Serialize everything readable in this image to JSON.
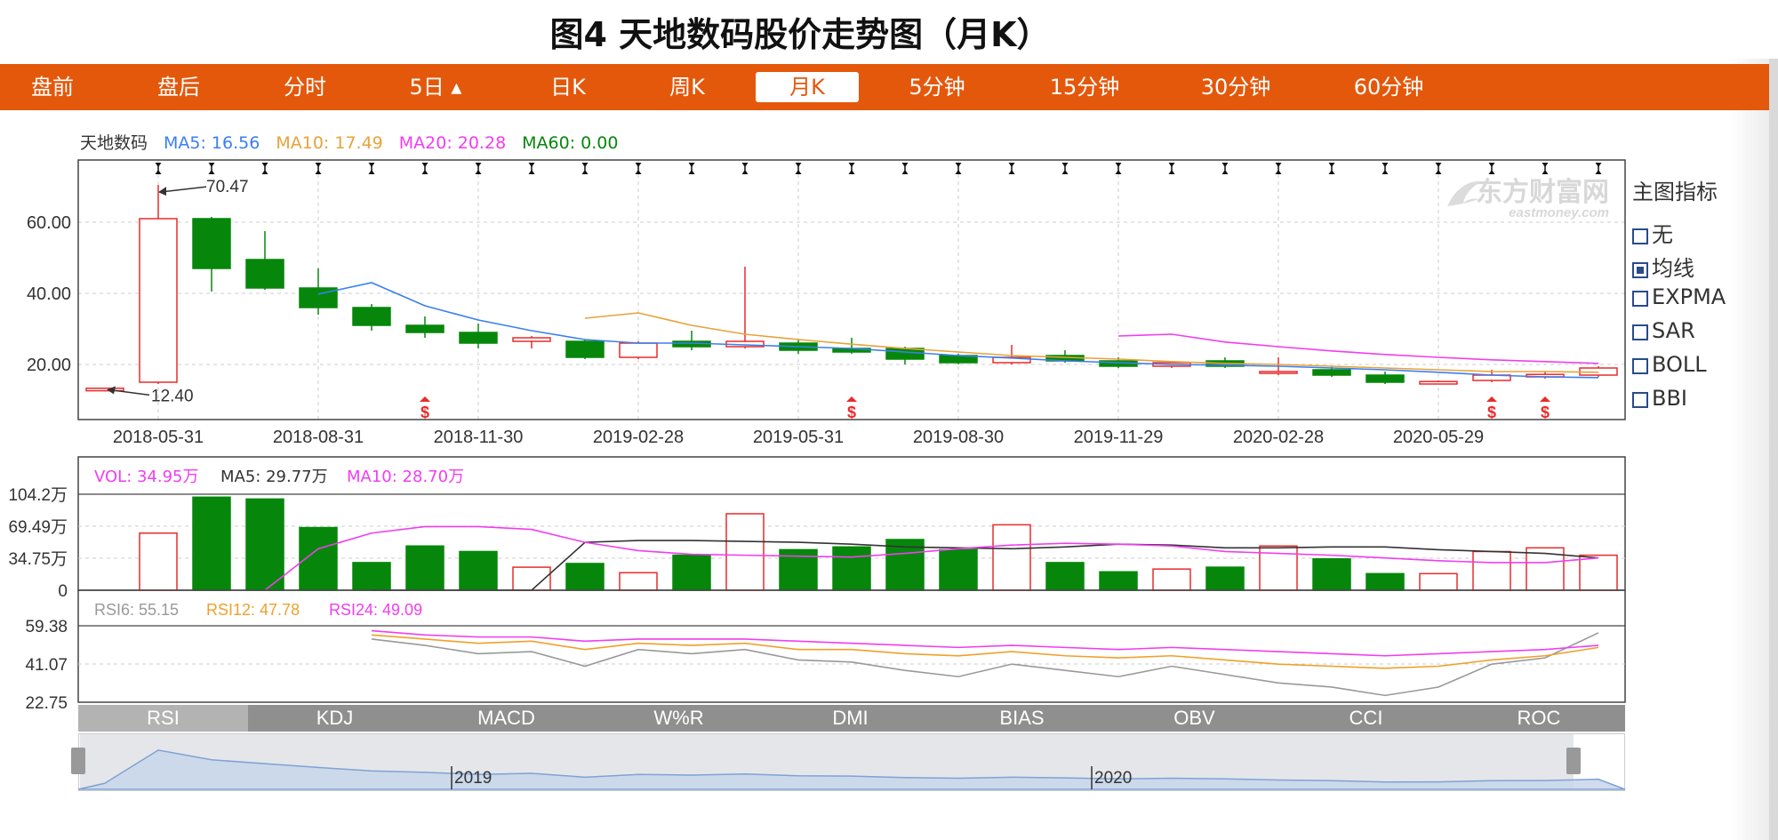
{
  "title": "图4 天地数码股价走势图（月K）",
  "tabs": [
    {
      "label": "盘前",
      "active": false
    },
    {
      "label": "盘后",
      "active": false
    },
    {
      "label": "分时",
      "active": false
    },
    {
      "label": "5日 ▴",
      "active": false
    },
    {
      "label": "日K",
      "active": false
    },
    {
      "label": "周K",
      "active": false
    },
    {
      "label": "月K",
      "active": true
    },
    {
      "label": "5分钟",
      "active": false
    },
    {
      "label": "15分钟",
      "active": false
    },
    {
      "label": "30分钟",
      "active": false
    },
    {
      "label": "60分钟",
      "active": false
    }
  ],
  "legend": {
    "stock": "天地数码",
    "ma5": "MA5: 16.56",
    "ma10": "MA10: 17.49",
    "ma20": "MA20: 20.28",
    "ma60": "MA60: 0.00"
  },
  "side_panel": {
    "title": "主图指标",
    "options": [
      {
        "label": "无",
        "checked": false
      },
      {
        "label": "均线",
        "checked": true
      },
      {
        "label": "EXPMA",
        "checked": false
      },
      {
        "label": "SAR",
        "checked": false
      },
      {
        "label": "BOLL",
        "checked": false
      },
      {
        "label": "BBI",
        "checked": false
      }
    ]
  },
  "indicator_tabs": [
    {
      "label": "RSI",
      "active": true
    },
    {
      "label": "KDJ",
      "active": false
    },
    {
      "label": "MACD",
      "active": false
    },
    {
      "label": "W%R",
      "active": false
    },
    {
      "label": "DMI",
      "active": false
    },
    {
      "label": "BIAS",
      "active": false
    },
    {
      "label": "OBV",
      "active": false
    },
    {
      "label": "CCI",
      "active": false
    },
    {
      "label": "ROC",
      "active": false
    }
  ],
  "watermark": {
    "cn": "东方财富网",
    "en": "eastmoney.com"
  },
  "navigator": {
    "labels": [
      "2019",
      "2020"
    ],
    "label_month_index": [
      7,
      19
    ]
  },
  "colors": {
    "orange": "#e4580b",
    "up": "#e82b2b",
    "down": "#06870b",
    "ma5": "#3b7ff0",
    "ma10": "#e8a23a",
    "ma20": "#f13df0",
    "ma60": "#06870b",
    "vol_ma5": "#333333",
    "rsi6": "#999999",
    "rsi12": "#f0a02b",
    "rsi24": "#f13df0"
  },
  "chart_data": [
    {
      "type": "candlestick",
      "x_tick_labels": [
        "2018-05-31",
        "2018-08-31",
        "2018-11-30",
        "2019-02-28",
        "2019-05-31",
        "2019-08-30",
        "2019-11-29",
        "2020-02-28",
        "2020-05-29"
      ],
      "x_tick_month_index": [
        1,
        4,
        7,
        10,
        13,
        16,
        19,
        22,
        25
      ],
      "y_tick_labels": [
        "60.00",
        "40.00",
        "20.00"
      ],
      "y_ticks": [
        60,
        40,
        20
      ],
      "ylim": [
        4.5,
        77.5
      ],
      "annotations": {
        "max_label": "70.47",
        "max_value": 70.47,
        "min_label": "12.40",
        "min_value": 12.4
      },
      "dividend_markers_month_index": [
        6,
        14,
        26,
        27
      ],
      "candles": [
        {
          "o": 12.6,
          "h": 13.5,
          "l": 12.4,
          "c": 13.3
        },
        {
          "o": 15.0,
          "h": 70.47,
          "l": 14.5,
          "c": 61.0
        },
        {
          "o": 61.0,
          "h": 61.5,
          "l": 40.5,
          "c": 47.0
        },
        {
          "o": 49.5,
          "h": 57.5,
          "l": 41.0,
          "c": 41.5
        },
        {
          "o": 41.5,
          "h": 47.0,
          "l": 34.0,
          "c": 36.0
        },
        {
          "o": 36.0,
          "h": 37.0,
          "l": 29.5,
          "c": 31.0
        },
        {
          "o": 31.0,
          "h": 33.5,
          "l": 27.5,
          "c": 29.0
        },
        {
          "o": 29.0,
          "h": 31.5,
          "l": 24.5,
          "c": 26.0
        },
        {
          "o": 26.5,
          "h": 28.0,
          "l": 24.5,
          "c": 27.5
        },
        {
          "o": 26.5,
          "h": 27.0,
          "l": 21.5,
          "c": 22.0
        },
        {
          "o": 22.0,
          "h": 26.5,
          "l": 21.5,
          "c": 26.0
        },
        {
          "o": 26.5,
          "h": 29.5,
          "l": 24.0,
          "c": 25.0
        },
        {
          "o": 25.0,
          "h": 47.5,
          "l": 24.5,
          "c": 26.5
        },
        {
          "o": 26.0,
          "h": 27.0,
          "l": 23.0,
          "c": 24.0
        },
        {
          "o": 24.5,
          "h": 27.5,
          "l": 23.0,
          "c": 23.5
        },
        {
          "o": 24.5,
          "h": 25.0,
          "l": 20.0,
          "c": 21.5
        },
        {
          "o": 22.5,
          "h": 23.0,
          "l": 20.0,
          "c": 20.5
        },
        {
          "o": 20.5,
          "h": 25.5,
          "l": 20.0,
          "c": 22.0
        },
        {
          "o": 22.5,
          "h": 24.0,
          "l": 20.5,
          "c": 21.0
        },
        {
          "o": 21.0,
          "h": 22.0,
          "l": 19.0,
          "c": 19.5
        },
        {
          "o": 19.5,
          "h": 21.0,
          "l": 19.0,
          "c": 20.5
        },
        {
          "o": 21.0,
          "h": 22.0,
          "l": 19.0,
          "c": 19.5
        },
        {
          "o": 17.5,
          "h": 22.0,
          "l": 17.0,
          "c": 18.0
        },
        {
          "o": 18.5,
          "h": 19.5,
          "l": 16.5,
          "c": 17.0
        },
        {
          "o": 17.0,
          "h": 18.0,
          "l": 14.5,
          "c": 15.0
        },
        {
          "o": 14.5,
          "h": 15.5,
          "l": 14.5,
          "c": 15.2
        },
        {
          "o": 15.5,
          "h": 18.5,
          "l": 15.0,
          "c": 17.0
        },
        {
          "o": 16.5,
          "h": 18.0,
          "l": 16.0,
          "c": 17.2
        },
        {
          "o": 17.0,
          "h": 19.5,
          "l": 16.5,
          "c": 19.0
        }
      ],
      "series": [
        {
          "name": "MA5",
          "start": 4,
          "values": [
            39.8,
            43.0,
            36.5,
            32.5,
            29.5,
            27.0,
            26.0,
            26.0,
            25.5,
            25.0,
            24.5,
            23.5,
            22.5,
            21.8,
            21.0,
            20.5,
            20.0,
            19.8,
            19.5,
            19.0,
            18.5,
            17.8,
            17.0,
            16.5,
            16.3
          ]
        },
        {
          "name": "MA10",
          "start": 9,
          "values": [
            33.0,
            34.5,
            31.0,
            28.5,
            27.0,
            25.7,
            24.5,
            23.5,
            22.5,
            22.0,
            21.5,
            20.8,
            20.3,
            20.0,
            19.5,
            19.0,
            18.5,
            18.0,
            18.0,
            17.8
          ]
        },
        {
          "name": "MA20",
          "start": 19,
          "values": [
            28.0,
            28.5,
            26.3,
            25.0,
            23.8,
            22.8,
            22.0,
            21.3,
            20.8,
            20.3
          ]
        }
      ]
    },
    {
      "type": "bar",
      "title": "VOL",
      "legend": {
        "vol": "VOL: 34.95万",
        "ma5": "MA5: 29.77万",
        "ma10": "MA10: 28.70万"
      },
      "y_tick_labels": [
        "104.2万",
        "69.49万",
        "34.75万",
        "0"
      ],
      "y_ticks": [
        104.2,
        69.49,
        34.75,
        0
      ],
      "ylim": [
        0,
        104.2
      ],
      "unit": "万",
      "values": [
        0,
        62,
        101,
        99,
        68,
        30,
        48,
        42,
        25,
        29,
        19,
        38,
        83,
        44,
        47,
        55,
        44,
        71,
        30,
        20,
        23,
        25,
        48,
        34,
        18,
        18,
        42,
        46,
        38
      ],
      "series": [
        {
          "name": "MA5",
          "start": 5,
          "values": [
            0,
            0,
            0,
            0,
            52,
            54,
            54,
            53,
            52,
            50,
            47,
            46,
            45,
            47,
            50,
            49,
            46,
            46,
            47,
            47,
            44,
            42,
            40,
            35
          ]
        },
        {
          "name": "MA10",
          "start": 3,
          "values": [
            0,
            45,
            62,
            69,
            69,
            66,
            52,
            43,
            39,
            38,
            37,
            36,
            40,
            45,
            49,
            51,
            50,
            48,
            42,
            40,
            38,
            35,
            32,
            30,
            30,
            35
          ]
        }
      ]
    },
    {
      "type": "line",
      "title": "RSI",
      "legend": {
        "rsi6": "RSI6: 55.15",
        "rsi12": "RSI12: 47.78",
        "rsi24": "RSI24: 49.09"
      },
      "y_tick_labels": [
        "59.38",
        "41.07",
        "22.75"
      ],
      "y_ticks": [
        59.38,
        41.07,
        22.75
      ],
      "ylim": [
        22.75,
        59.38
      ],
      "series": [
        {
          "name": "RSI6",
          "start": 5,
          "values": [
            53,
            50,
            46,
            47,
            40,
            48,
            46,
            48,
            43,
            42,
            38,
            35,
            41,
            38,
            35,
            40,
            36,
            32,
            30,
            26,
            30,
            41,
            44,
            56
          ]
        },
        {
          "name": "RSI12",
          "start": 5,
          "values": [
            55,
            53,
            51,
            52,
            48,
            51,
            50,
            51,
            48,
            48,
            46,
            45,
            47,
            45,
            44,
            45,
            43,
            41,
            40,
            39,
            40,
            43,
            45,
            49
          ]
        },
        {
          "name": "RSI24",
          "start": 5,
          "values": [
            57,
            55,
            54,
            54,
            52,
            53,
            53,
            53,
            52,
            51,
            50,
            49,
            50,
            49,
            48,
            49,
            48,
            47,
            46,
            45,
            46,
            47,
            48,
            50
          ]
        }
      ]
    }
  ]
}
